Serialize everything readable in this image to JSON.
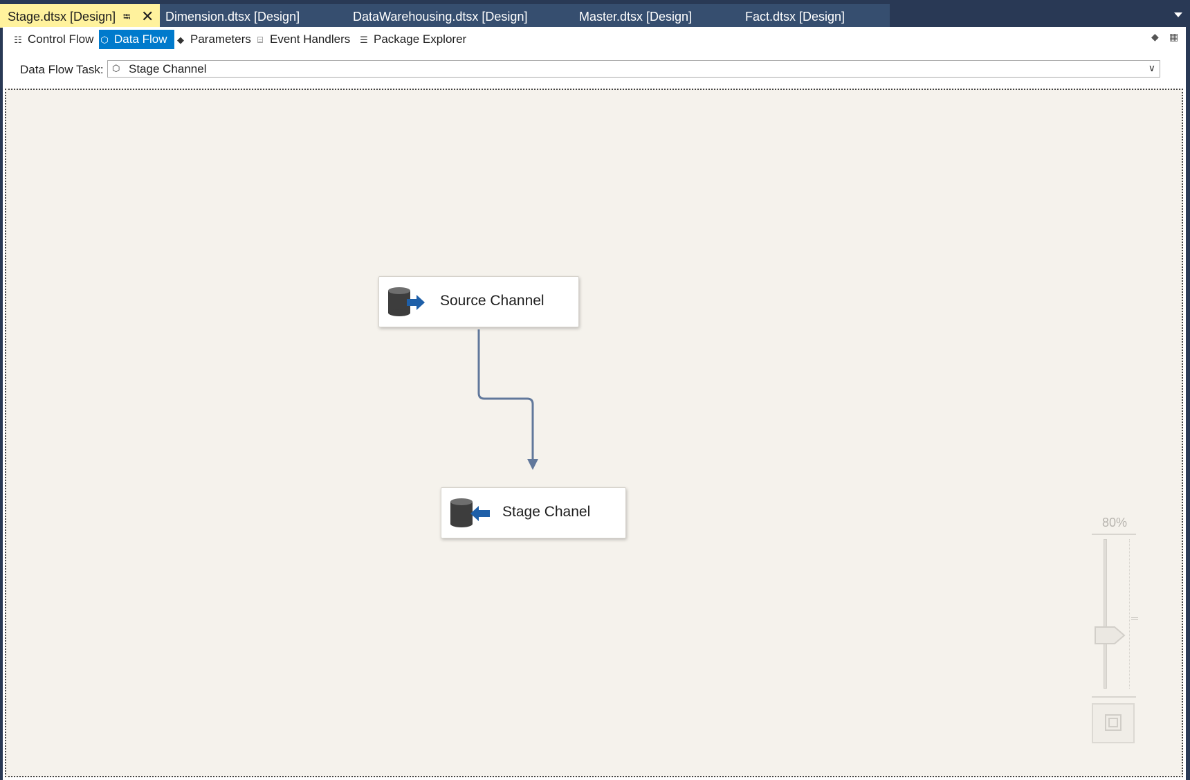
{
  "doc_tabs": [
    {
      "label": "Stage.dtsx [Design]",
      "active": true
    },
    {
      "label": "Dimension.dtsx [Design]"
    },
    {
      "label": "DataWarehousing.dtsx [Design]"
    },
    {
      "label": "Master.dtsx [Design]"
    },
    {
      "label": "Fact.dtsx [Design]"
    }
  ],
  "designer_tabs": [
    {
      "label": "Control Flow",
      "icon": "control-flow-icon"
    },
    {
      "label": "Data Flow",
      "icon": "data-flow-icon",
      "selected": true
    },
    {
      "label": "Parameters",
      "icon": "parameters-icon"
    },
    {
      "label": "Event Handlers",
      "icon": "event-handlers-icon"
    },
    {
      "label": "Package Explorer",
      "icon": "package-explorer-icon"
    }
  ],
  "data_flow_task": {
    "label": "Data Flow Task:",
    "value": "Stage Channel"
  },
  "components": [
    {
      "name": "Source Channel",
      "type": "source",
      "icon": "database-source-icon"
    },
    {
      "name": "Stage Chanel",
      "type": "destination",
      "icon": "database-destination-icon"
    }
  ],
  "zoom": {
    "value": "80%"
  },
  "colors": {
    "active_tab": "#fff29d",
    "selected_subtab": "#007acc",
    "canvas": "#f5f2ec",
    "connector": "#61789b",
    "arrow_blue": "#1e5fa8"
  }
}
